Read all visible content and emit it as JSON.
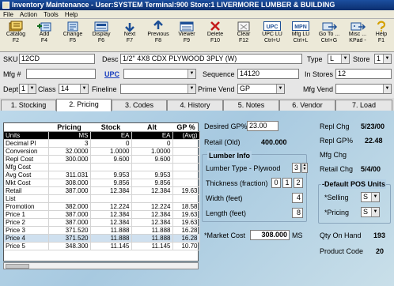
{
  "window": {
    "title": "Inventory Maintenance - User:SYSTEM Terminal:900 Store:1 LIVERMORE LUMBER & BUILDING"
  },
  "menu": [
    "File",
    "Action",
    "Tools",
    "Help"
  ],
  "toolbar": [
    {
      "label": "Catalog",
      "key": "F2",
      "icon": "catalog-icon"
    },
    {
      "label": "Add",
      "key": "F4",
      "icon": "add-icon"
    },
    {
      "label": "Change",
      "key": "F5",
      "icon": "change-icon"
    },
    {
      "label": "Display",
      "key": "F6",
      "icon": "display-icon"
    },
    {
      "label": "Next",
      "key": "F7",
      "icon": "next-icon"
    },
    {
      "label": "Previous",
      "key": "F8",
      "icon": "previous-icon"
    },
    {
      "label": "Viewer",
      "key": "F9",
      "icon": "viewer-icon"
    },
    {
      "label": "Delete",
      "key": "F10",
      "icon": "delete-icon"
    },
    {
      "label": "Clear",
      "key": "F12",
      "icon": "clear-icon"
    },
    {
      "label": "UPC LU",
      "key": "Ctrl+U",
      "icon": "upc-icon",
      "badge": "UPC"
    },
    {
      "label": "Mfg LU",
      "key": "Ctrl+L",
      "icon": "mpn-icon",
      "badge": "MPN"
    },
    {
      "label": "Go To ...",
      "key": "Ctrl+G",
      "icon": "goto-icon"
    },
    {
      "label": "Misc ...",
      "key": "KPad -",
      "icon": "misc-icon"
    },
    {
      "label": "Help",
      "key": "F1",
      "icon": "help-icon"
    }
  ],
  "form": {
    "sku_label": "SKU",
    "sku": "12CD",
    "desc_label": "Desc",
    "desc": "1/2\" 4X8 CDX PLYWOOD 3PLY (W)",
    "type_label": "Type",
    "type": "L",
    "store_label": "Store",
    "store": "1",
    "mfg_label": "Mfg #",
    "mfg": "",
    "upc_label": "UPC",
    "upc": "",
    "sequence_label": "Sequence",
    "sequence": "14120",
    "in_stores_label": "In Stores",
    "in_stores": "12",
    "dept_label": "Dept",
    "dept": "1",
    "class_label": "Class",
    "class": "14",
    "fineline_label": "Fineline",
    "fineline": "",
    "prime_vend_label": "Prime Vend",
    "prime_vend": "GP",
    "mfg_vend_label": "Mfg Vend",
    "mfg_vend": ""
  },
  "tabs": [
    "1. Stocking",
    "2. Pricing",
    "3. Codes",
    "4. History",
    "5. Notes",
    "6. Vendor",
    "7. Load"
  ],
  "active_tab": "2. Pricing",
  "grid": {
    "headers": [
      "",
      "Pricing",
      "Stock",
      "Alt",
      "GP %"
    ],
    "rows": [
      [
        "Units",
        "MS",
        "EA",
        "EA",
        "(Avg)"
      ],
      [
        "Decimal Pl",
        "3",
        "0",
        "0",
        ""
      ],
      [
        "Conversion",
        "32.0000",
        "1.0000",
        "1.0000",
        ""
      ],
      [
        "Repl Cost",
        "300.000",
        "9.600",
        "9.600",
        ""
      ],
      [
        "Mfg Cost",
        "",
        "",
        "",
        ""
      ],
      [
        "Avg Cost",
        "311.031",
        "9.953",
        "9.953",
        ""
      ],
      [
        "Mkt Cost",
        "308.000",
        "9.856",
        "9.856",
        ""
      ],
      [
        "Retail",
        "387.000",
        "12.384",
        "12.384",
        "19.63"
      ],
      [
        "List",
        "",
        "",
        "",
        ""
      ],
      [
        "Promotion",
        "382.000",
        "12.224",
        "12.224",
        "18.58"
      ],
      [
        "Price 1",
        "387.000",
        "12.384",
        "12.384",
        "19.63"
      ],
      [
        "Price 2",
        "387.000",
        "12.384",
        "12.384",
        "19.63"
      ],
      [
        "Price 3",
        "371.520",
        "11.888",
        "11.888",
        "16.28"
      ],
      [
        "Price 4",
        "371.520",
        "11.888",
        "11.888",
        "16.28"
      ],
      [
        "Price 5",
        "348.300",
        "11.145",
        "11.145",
        "10.70"
      ]
    ]
  },
  "pricing": {
    "desired_gp_label": "Desired GP%",
    "desired_gp": "23.00",
    "retail_old_label": "Retail (Old)",
    "retail_old": "400.000",
    "repl_chg_label": "Repl Chg",
    "repl_chg": "5/23/00",
    "repl_gp_label": "Repl GP%",
    "repl_gp": "22.48",
    "mfg_chg_label": "Mfg Chg",
    "mfg_chg": "",
    "retail_chg_label": "Retail Chg",
    "retail_chg": "5/4/00",
    "lumber_info_label": "Lumber Info",
    "lumber_type_label": "Lumber Type - Plywood",
    "lumber_type": "3",
    "thickness_label": "Thickness (fraction)",
    "thickness": [
      "0",
      "1",
      "2"
    ],
    "width_label": "Width (feet)",
    "width": "4",
    "length_label": "Length (feet)",
    "length": "8",
    "market_cost_label": "*Market Cost",
    "market_cost": "308.000",
    "market_cost_unit": "MS",
    "default_pos_label": "-Default POS Units",
    "selling_label": "*Selling",
    "selling": "S",
    "pricing_label": "*Pricing",
    "pricing": "S",
    "qty_on_hand_label": "Qty On Hand",
    "qty_on_hand": "193",
    "product_code_label": "Product Code",
    "product_code": "20"
  }
}
